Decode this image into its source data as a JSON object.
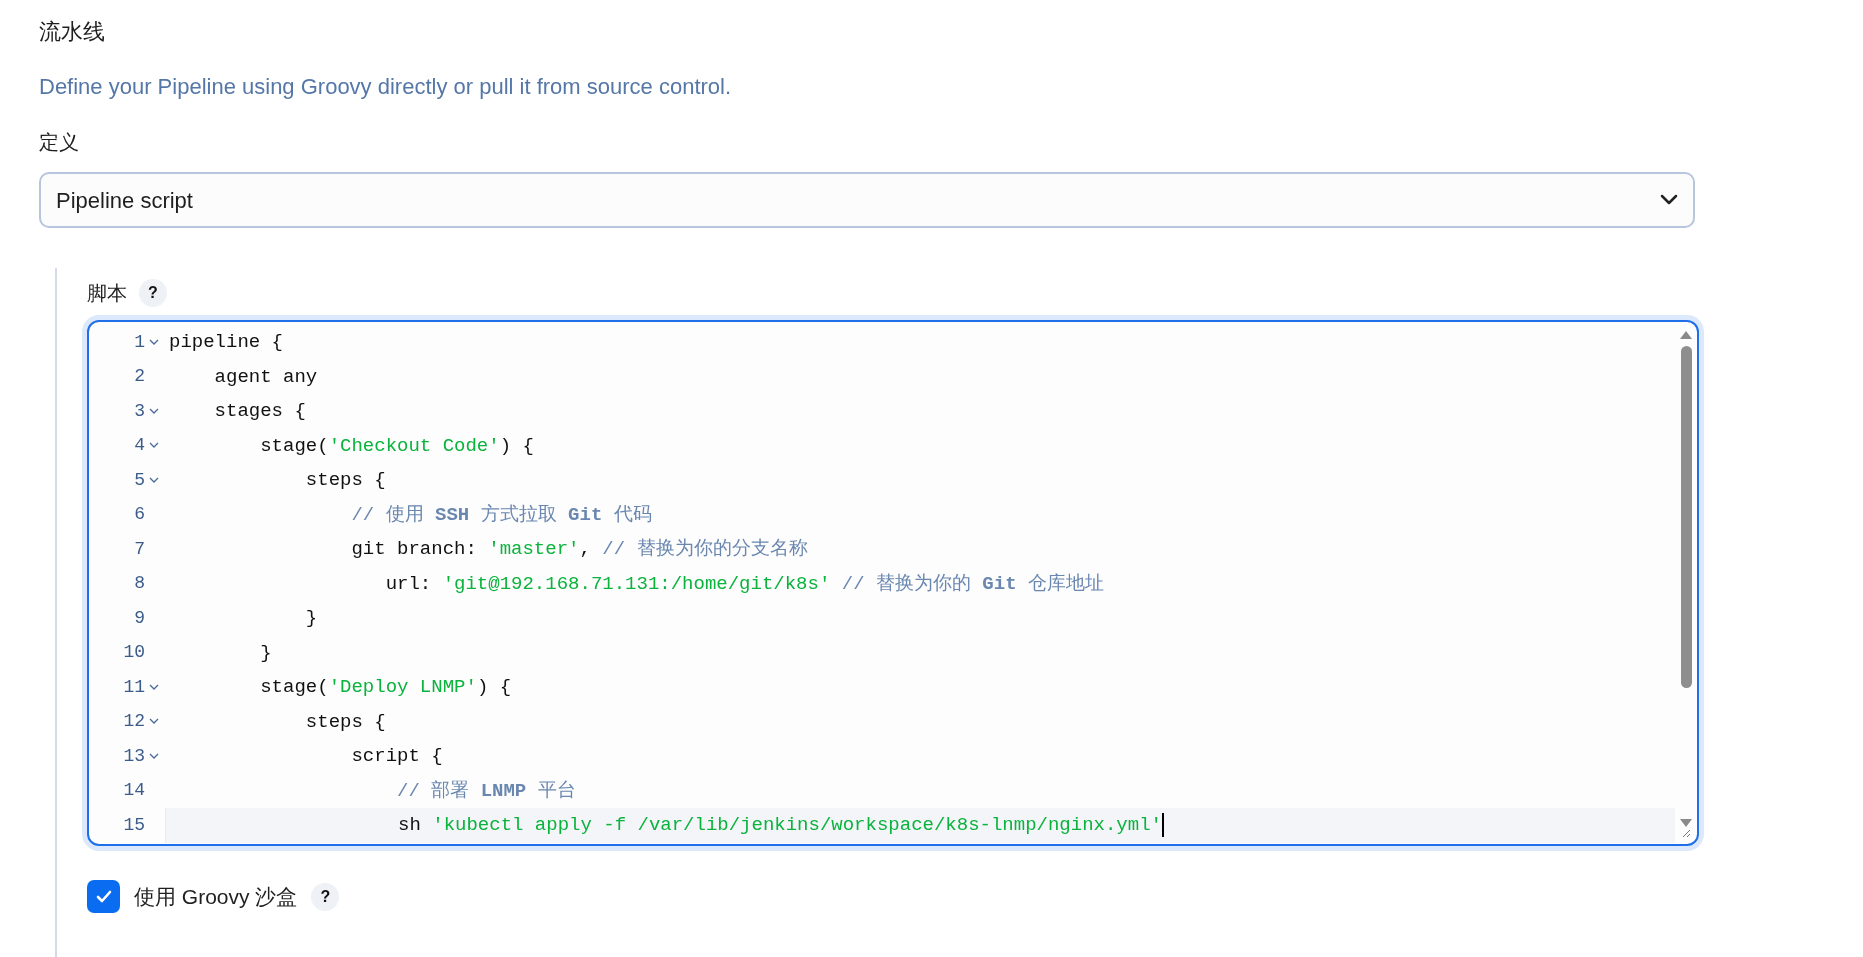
{
  "section_title": "流水线",
  "description": "Define your Pipeline using Groovy directly or pull it from source control.",
  "definition": {
    "label": "定义",
    "value": "Pipeline script"
  },
  "script": {
    "label": "脚本",
    "help": "?",
    "lines": [
      {
        "number": "1",
        "foldable": true,
        "active": false,
        "tokens": [
          {
            "kind": "plain",
            "text": "pipeline {"
          }
        ]
      },
      {
        "number": "2",
        "foldable": false,
        "active": false,
        "tokens": [
          {
            "kind": "plain",
            "text": "    agent any"
          }
        ]
      },
      {
        "number": "3",
        "foldable": true,
        "active": false,
        "tokens": [
          {
            "kind": "plain",
            "text": "    stages {"
          }
        ]
      },
      {
        "number": "4",
        "foldable": true,
        "active": false,
        "tokens": [
          {
            "kind": "plain",
            "text": "        stage("
          },
          {
            "kind": "string",
            "text": "'Checkout Code'"
          },
          {
            "kind": "plain",
            "text": ") {"
          }
        ]
      },
      {
        "number": "5",
        "foldable": true,
        "active": false,
        "tokens": [
          {
            "kind": "plain",
            "text": "            steps {"
          }
        ]
      },
      {
        "number": "6",
        "foldable": false,
        "active": false,
        "tokens": [
          {
            "kind": "comment",
            "text": "                // 使用 **SSH** 方式拉取 **Git** 代码"
          }
        ]
      },
      {
        "number": "7",
        "foldable": false,
        "active": false,
        "tokens": [
          {
            "kind": "plain",
            "text": "                git branch: "
          },
          {
            "kind": "string",
            "text": "'master'"
          },
          {
            "kind": "plain",
            "text": ", "
          },
          {
            "kind": "comment",
            "text": "// 替换为你的分支名称"
          }
        ]
      },
      {
        "number": "8",
        "foldable": false,
        "active": false,
        "tokens": [
          {
            "kind": "plain",
            "text": "                   url: "
          },
          {
            "kind": "string",
            "text": "'git@192.168.71.131:/home/git/k8s'"
          },
          {
            "kind": "comment",
            "text": " // 替换为你的 **Git** 仓库地址"
          }
        ]
      },
      {
        "number": "9",
        "foldable": false,
        "active": false,
        "tokens": [
          {
            "kind": "plain",
            "text": "            }"
          }
        ]
      },
      {
        "number": "10",
        "foldable": false,
        "active": false,
        "tokens": [
          {
            "kind": "plain",
            "text": "        }"
          }
        ]
      },
      {
        "number": "11",
        "foldable": true,
        "active": false,
        "tokens": [
          {
            "kind": "plain",
            "text": "        stage("
          },
          {
            "kind": "string",
            "text": "'Deploy LNMP'"
          },
          {
            "kind": "plain",
            "text": ") {"
          }
        ]
      },
      {
        "number": "12",
        "foldable": true,
        "active": false,
        "tokens": [
          {
            "kind": "plain",
            "text": "            steps {"
          }
        ]
      },
      {
        "number": "13",
        "foldable": true,
        "active": false,
        "tokens": [
          {
            "kind": "plain",
            "text": "                script {"
          }
        ]
      },
      {
        "number": "14",
        "foldable": false,
        "active": false,
        "tokens": [
          {
            "kind": "comment",
            "text": "                    // 部署 **LNMP** 平台"
          }
        ]
      },
      {
        "number": "15",
        "foldable": false,
        "active": true,
        "tokens": [
          {
            "kind": "plain",
            "text": "                    sh "
          },
          {
            "kind": "string",
            "text": "'kubectl apply -f /var/lib/jenkins/workspace/k8s-lnmp/nginx.yml'"
          }
        ]
      }
    ]
  },
  "sandbox": {
    "label": "使用 Groovy 沙盒",
    "checked": true,
    "help": "?"
  }
}
